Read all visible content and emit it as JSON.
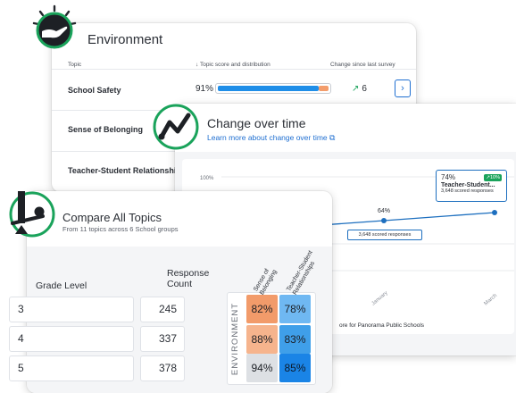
{
  "environment": {
    "title": "Environment",
    "columns": {
      "topic": "Topic",
      "score": "Topic score and distribution",
      "change": "Change since last survey"
    },
    "rows": [
      {
        "topic": "School Safety",
        "score": "91%",
        "change": "6"
      },
      {
        "topic": "Sense of Belonging"
      },
      {
        "topic": "Teacher-Student Relationships"
      }
    ]
  },
  "change_over_time": {
    "title": "Change over time",
    "link": "Learn more about change over time",
    "y_tick": "100%",
    "tooltip_main": {
      "score": "74%",
      "change": "10%",
      "topic": "Teacher-Student...",
      "responses": "3,648 scored responses"
    },
    "point_label": "64%",
    "point_box": "3,648 scored responses",
    "x_ticks": [
      "January",
      "March"
    ],
    "footer_partial": "ore for Panorama Public Schools"
  },
  "compare": {
    "title": "Compare All Topics",
    "subtitle": "From 11 topics across 6 School groups",
    "grade_header": "Grade Level",
    "count_header_1": "Response",
    "count_header_2": "Count",
    "group_label": "ENVIRONMENT",
    "col_headers": [
      [
        "Sense of",
        "Belonging"
      ],
      [
        "Teacher-Student",
        "Relationships"
      ]
    ],
    "rows": [
      {
        "grade": "3",
        "count": "245",
        "cells": [
          "82%",
          "78%"
        ]
      },
      {
        "grade": "4",
        "count": "337",
        "cells": [
          "88%",
          "83%"
        ]
      },
      {
        "grade": "5",
        "count": "378",
        "cells": [
          "94%",
          "85%"
        ]
      }
    ]
  },
  "colors": {
    "accent_blue": "#1f8ee8",
    "link_blue": "#1f6fd1",
    "green": "#1aa35b",
    "orange": "#f39d6c"
  }
}
